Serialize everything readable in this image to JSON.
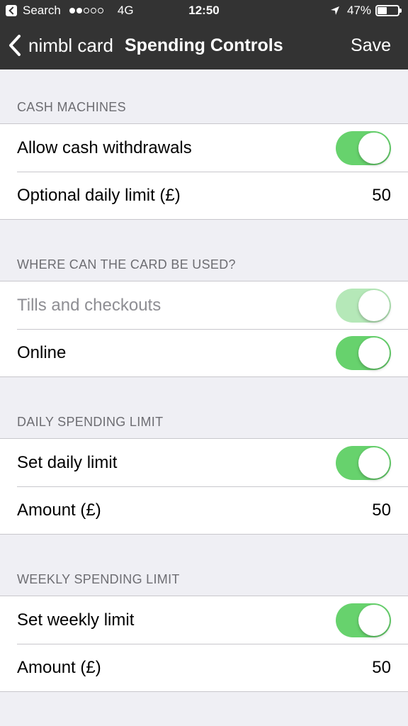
{
  "status_bar": {
    "back_app": "Search",
    "network": "4G",
    "time": "12:50",
    "battery": "47%",
    "battery_level": 0.47
  },
  "nav": {
    "back_label": "nimbl card",
    "title": "Spending Controls",
    "save_label": "Save"
  },
  "sections": {
    "cash": {
      "header": "CASH MACHINES",
      "allow_withdrawals": {
        "label": "Allow cash withdrawals",
        "on": true
      },
      "daily_limit": {
        "label": "Optional daily limit (£)",
        "value": "50"
      }
    },
    "usage": {
      "header": "WHERE CAN THE CARD BE USED?",
      "tills": {
        "label": "Tills and checkouts",
        "on": true,
        "disabled": true
      },
      "online": {
        "label": "Online",
        "on": true
      }
    },
    "daily": {
      "header": "DAILY SPENDING LIMIT",
      "set_limit": {
        "label": "Set daily limit",
        "on": true
      },
      "amount": {
        "label": "Amount (£)",
        "value": "50"
      }
    },
    "weekly": {
      "header": "WEEKLY SPENDING LIMIT",
      "set_limit": {
        "label": "Set weekly limit",
        "on": true
      },
      "amount": {
        "label": "Amount (£)",
        "value": "50"
      }
    }
  },
  "colors": {
    "nav_background": "#333333",
    "toggle_on": "#67d26d",
    "toggle_disabled": "#b5e8b8",
    "page_background": "#efeff4"
  }
}
